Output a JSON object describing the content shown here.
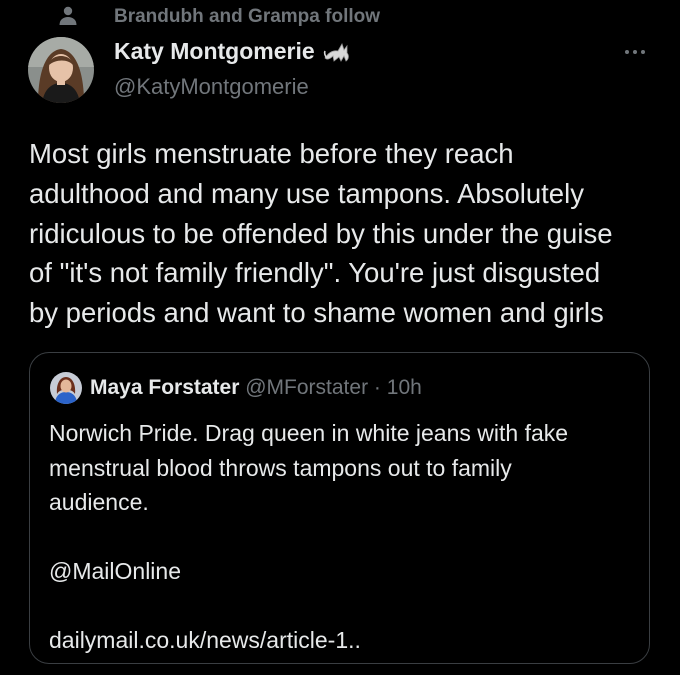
{
  "social_context": {
    "icon": "person-icon",
    "text": "Brandubh and Grampa follow"
  },
  "author": {
    "name": "Katy Montgomerie",
    "name_emoji": "cat-emoji",
    "handle": "@KatyMontgomerie",
    "avatar": "avatar"
  },
  "more_icon": "more-dots-icon",
  "tweet": {
    "text": "Most girls menstruate before they reach\nadulthood and many use tampons. Absolutely\nridiculous to be offended by this under the guise\nof \"it's not family friendly\". You're just disgusted\nby periods and want to shame women and girls"
  },
  "quote": {
    "name": "Maya Forstater",
    "handle": "@MForstater",
    "separator": "·",
    "time": "10h",
    "text": "Norwich Pride. Drag queen in white jeans with fake\nmenstrual blood throws tampons out to family\naudience.\n\n@MailOnline\n\ndailymail.co.uk/news/article-1.."
  },
  "colors": {
    "background": "#000000",
    "primary_text": "#e7e9ea",
    "secondary_text": "#71767b",
    "border": "#3a3e42"
  }
}
